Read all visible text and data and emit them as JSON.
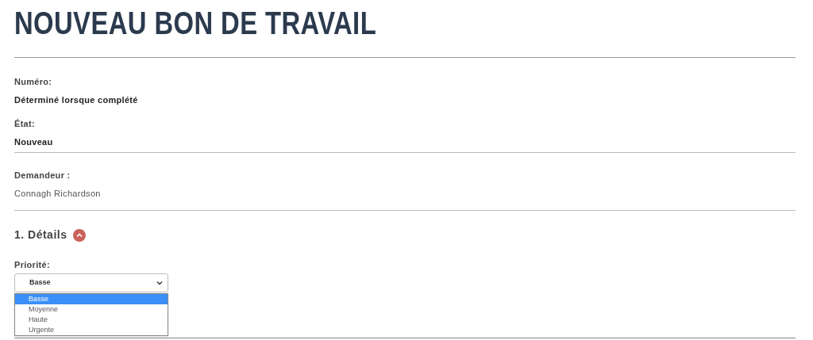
{
  "title": "NOUVEAU BON DE TRAVAIL",
  "info": [
    {
      "label": "Numéro:",
      "value": "Déterminé lorsque complété"
    },
    {
      "label": "État:",
      "value": "Nouveau"
    }
  ],
  "requester": {
    "label": "Demandeur :",
    "value": "Connagh Richardson"
  },
  "section": {
    "title": "1. Détails",
    "expanded": true
  },
  "priority": {
    "label": "Priorité:",
    "value": "Basse",
    "open": true,
    "options": [
      {
        "label": "Basse",
        "selected": true
      },
      {
        "label": "Moyenne",
        "selected": false
      },
      {
        "label": "Haute",
        "selected": false
      },
      {
        "label": "Urgente",
        "selected": false
      }
    ]
  }
}
